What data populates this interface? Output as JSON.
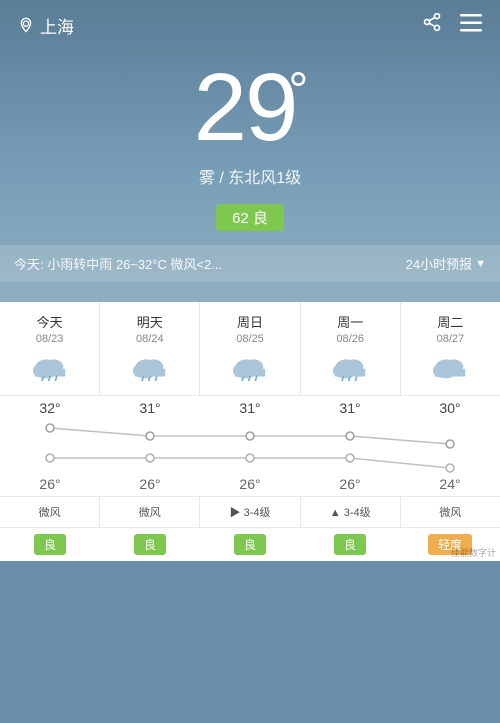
{
  "header": {
    "location": "上海",
    "share_icon": "↗",
    "menu_icon": "≡"
  },
  "current": {
    "temperature": "29",
    "unit": "°",
    "weather": "雾",
    "wind": "东北风1级",
    "separator": " / ",
    "aqi_value": "62",
    "aqi_label": "良"
  },
  "today_bar": {
    "text": "今天: 小雨转中雨  26~32°C  微风<2...",
    "forecast_link": "24小时预报"
  },
  "forecast": {
    "days": [
      {
        "label": "今天",
        "date": "08/23",
        "weather_icon": "cloud-rain",
        "high": "32°",
        "low": "26°",
        "wind": "微风",
        "aqi": "良",
        "aqi_class": "aqi-good"
      },
      {
        "label": "明天",
        "date": "08/24",
        "weather_icon": "cloud-rain",
        "high": "31°",
        "low": "26°",
        "wind": "微风",
        "aqi": "良",
        "aqi_class": "aqi-good"
      },
      {
        "label": "周日",
        "date": "08/25",
        "weather_icon": "cloud-rain",
        "high": "31°",
        "low": "26°",
        "wind": "▶ 3-4级",
        "aqi": "良",
        "aqi_class": "aqi-good"
      },
      {
        "label": "周一",
        "date": "08/26",
        "weather_icon": "cloud-rain",
        "high": "31°",
        "low": "26°",
        "wind": "▲ 3-4级",
        "aqi": "良",
        "aqi_class": "aqi-good"
      },
      {
        "label": "周二",
        "date": "08/27",
        "weather_icon": "cloud",
        "high": "30°",
        "low": "24°",
        "wind": "微风",
        "aqi": "轻度",
        "aqi_class": "aqi-moderate"
      }
    ],
    "chart": {
      "high_points": [
        100,
        80,
        80,
        80,
        65
      ],
      "low_points": [
        45,
        45,
        45,
        45,
        30
      ]
    }
  },
  "brand": "佳能数字计"
}
